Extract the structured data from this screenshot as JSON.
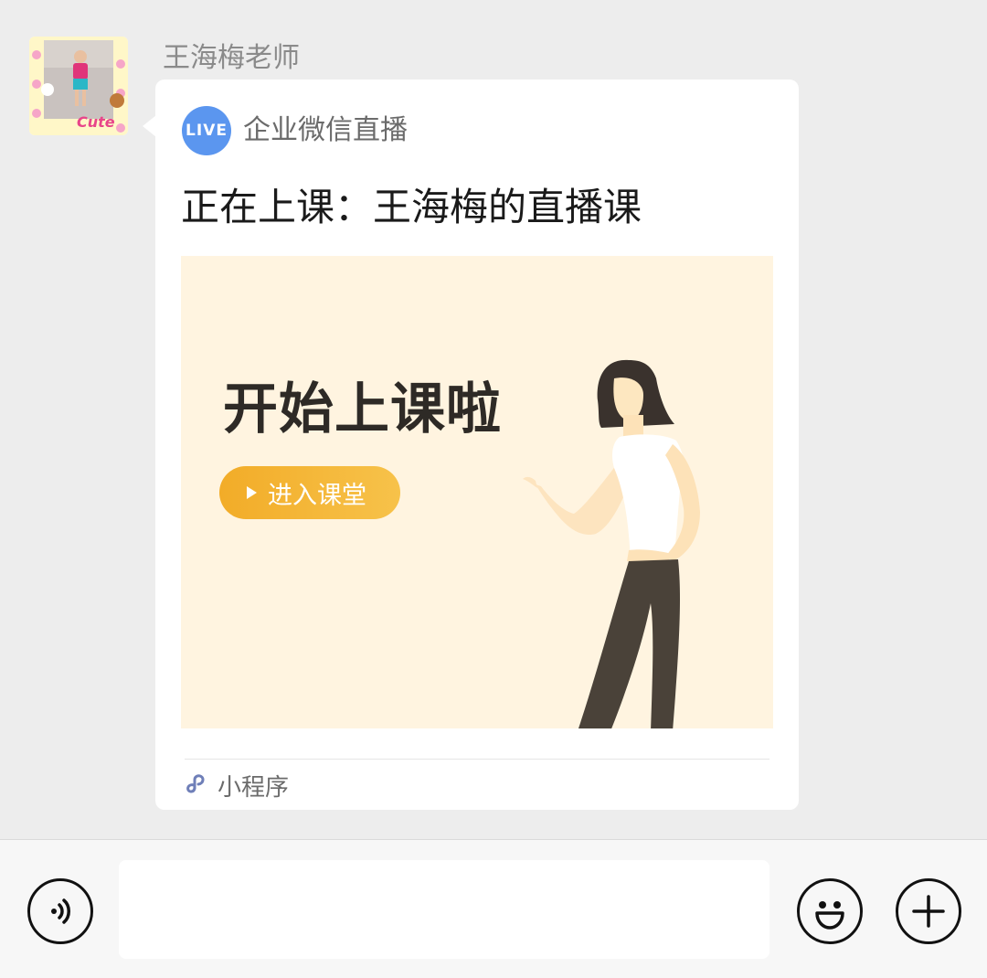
{
  "chat": {
    "sender_name": "王海梅老师",
    "avatar_icon": "child-photo-avatar",
    "avatar_caption": "Cute"
  },
  "card": {
    "live_badge": "LIVE",
    "source_name": "企业微信直播",
    "title": "正在上课：王海梅的直播课",
    "banner": {
      "heading": "开始上课啦",
      "button_label": "进入课堂",
      "background_color": "#fff4e0",
      "button_color": "#f2ac28"
    },
    "footer_label": "小程序",
    "footer_icon": "mini-program-icon",
    "accent_color": "#5b96ef"
  },
  "input_bar": {
    "voice_icon": "voice-icon",
    "emoji_icon": "emoji-icon",
    "plus_icon": "plus-icon",
    "message_value": ""
  }
}
